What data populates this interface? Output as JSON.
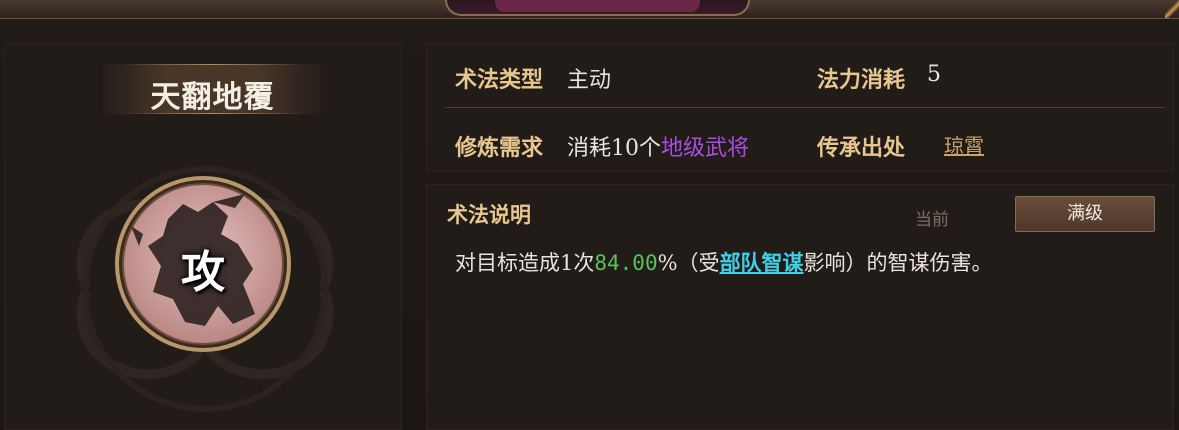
{
  "skill": {
    "name": "天翻地覆",
    "icon_char": "攻",
    "icon_name": "warrior-silhouette-icon"
  },
  "info": {
    "type_label": "术法类型",
    "type_value": "主动",
    "cost_label": "法力消耗",
    "cost_value": "5",
    "req_label": "修炼需求",
    "req_prefix": "消耗10个",
    "req_highlight": "地级武将",
    "source_label": "传承出处",
    "source_value": "琼霄"
  },
  "description": {
    "title": "术法说明",
    "tab_current": "当前",
    "tab_max": "满级",
    "text_1": "对目标造成1次",
    "percent": "84.00",
    "text_2": "%（受",
    "link": "部队智谋",
    "text_3": "影响）的智谋伤害。"
  },
  "colors": {
    "label_gold": "#e8c78f",
    "highlight_purple": "#a64ee0",
    "percent_green": "#56c25a",
    "link_cyan": "#3fd0e8",
    "source_link": "#c9a26e"
  }
}
